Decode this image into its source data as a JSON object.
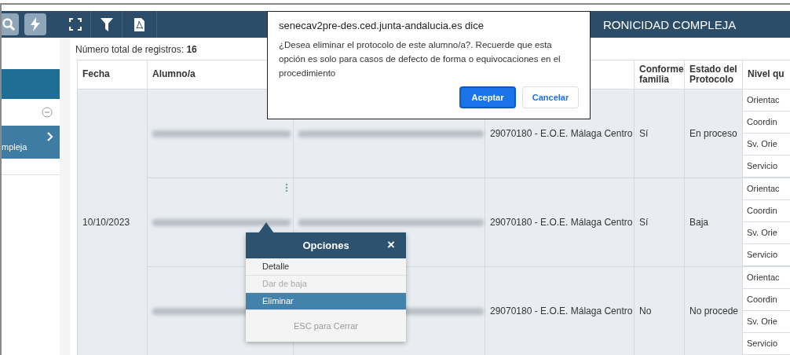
{
  "sidebar": {
    "section_label": "mpleja"
  },
  "header": {
    "title": "RONICIDAD COMPLEJA"
  },
  "record_count": {
    "label": "Número total de registros:",
    "value": "16"
  },
  "table": {
    "columns": [
      "Fecha",
      "Alumno/a",
      "",
      "",
      "Conforme familia",
      "Estado del Protocolo",
      "Nivel qu"
    ],
    "date": "10/10/2023",
    "rows": [
      {
        "centro": "29070180 - E.O.E. Málaga Centro",
        "conforme": "Sí",
        "estado": "En proceso",
        "nivel": [
          "Orientac",
          "Coordin",
          "Sv. Orie",
          "Servicio"
        ]
      },
      {
        "centro": "29070180 - E.O.E. Málaga Centro",
        "conforme": "Sí",
        "estado": "Baja",
        "options_icon": true,
        "nivel": [
          "Orientac",
          "Coordin",
          "Sv. Orie",
          "Servicio"
        ]
      },
      {
        "centro": "29070180 - E.O.E. Málaga Centro",
        "conforme": "No",
        "estado": "No procede",
        "nivel": [
          "Orientac",
          "Coordin",
          "Sv. Orie",
          "Servicio"
        ]
      }
    ]
  },
  "options_menu": {
    "title": "Opciones",
    "close": "×",
    "items": [
      {
        "label": "Detalle",
        "disabled": false,
        "selected": false
      },
      {
        "label": "Dar de baja",
        "disabled": true,
        "selected": false
      },
      {
        "label": "Eliminar",
        "disabled": false,
        "selected": true
      }
    ],
    "footer": "ESC para Cerrar"
  },
  "dialog": {
    "title": "senecav2pre-des.ced.junta-andalucia.es dice",
    "message": "¿Desea eliminar el protocolo de este alumno/a?. Recuerde que esta opción es solo para casos de defecto de forma o equivocaciones en el procedimiento",
    "buttons": [
      {
        "label": "Aceptar",
        "kind": "primary"
      },
      {
        "label": "Cancelar",
        "kind": "secondary"
      }
    ]
  }
}
